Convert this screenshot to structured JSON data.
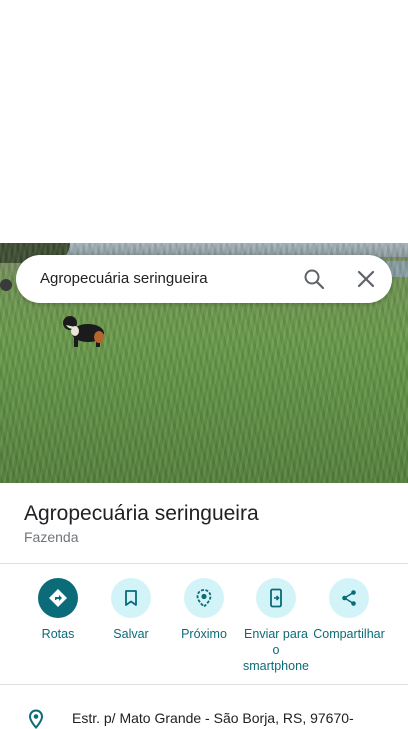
{
  "search": {
    "query": "Agropecuária seringueira"
  },
  "place": {
    "name": "Agropecuária seringueira",
    "category": "Fazenda"
  },
  "actions": [
    {
      "label": "Rotas",
      "icon": "directions-icon"
    },
    {
      "label": "Salvar",
      "icon": "bookmark-icon"
    },
    {
      "label": "Próximo",
      "icon": "nearby-icon"
    },
    {
      "label": "Enviar para o smartphone",
      "icon": "send-to-phone-icon"
    },
    {
      "label": "Compartilhar",
      "icon": "share-icon"
    }
  ],
  "address": "Estr. p/ Mato Grande - São Borja, RS, 97670-",
  "colors": {
    "accent": "#0b6b78",
    "chip_bg": "#d2f4f8",
    "text": "#202124",
    "secondary": "#70757a"
  }
}
